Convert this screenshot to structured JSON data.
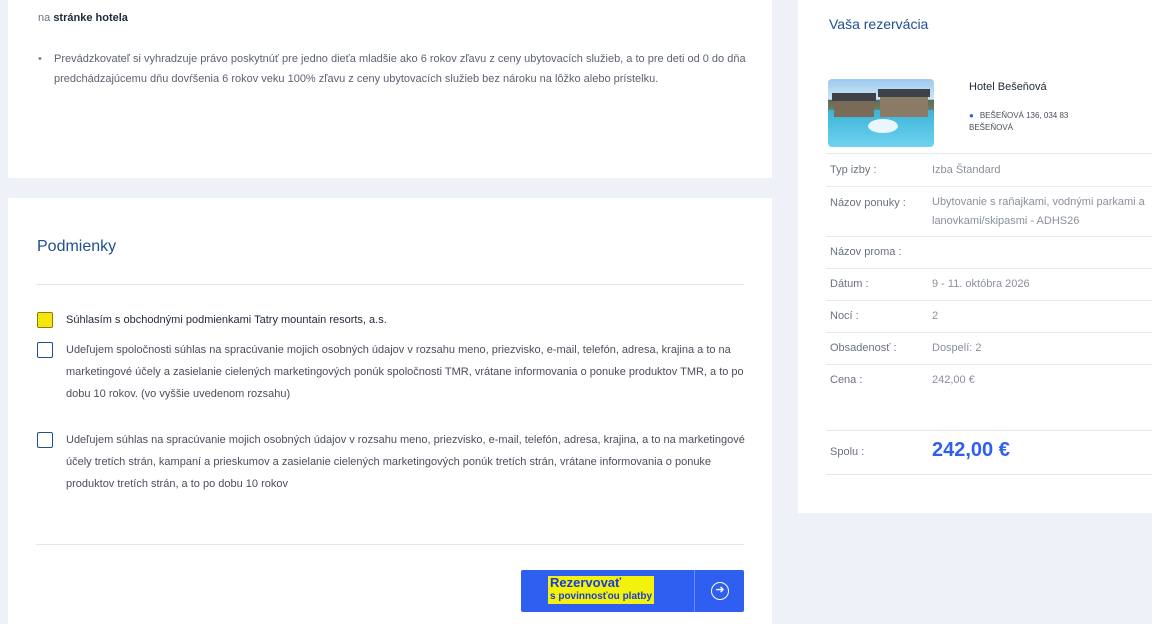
{
  "intro": {
    "prefix": "na",
    "link": "stránke hotela",
    "bullet": "Prevádzkovateľ si vyhradzuje právo poskytnúť pre jedno dieťa mladšie ako 6 rokov zľavu z ceny ubytovacích služieb, a to pre deti od 0 do dňa predchádzajúcemu dňu dovŕšenia 6 rokov veku 100% zľavu z ceny ubytovacích služieb bez nároku na lôžko alebo prístelku."
  },
  "conditions": {
    "title": "Podmienky",
    "items": [
      {
        "label": "Súhlasím s obchodnými podmienkami Tatry mountain resorts, a.s.",
        "checked": false,
        "highlighted": true
      },
      {
        "label": "Udeľujem spoločnosti súhlas na spracúvanie mojich osobných údajov v rozsahu meno, priezvisko, e-mail, telefón, adresa, krajina a to na marketingové účely a zasielanie cielených marketingových ponúk spoločnosti TMR, vrátane informovania o ponuke produktov TMR, a to po dobu 10 rokov. (vo vyššie uvedenom rozsahu)",
        "checked": false
      },
      {
        "label": "Udeľujem súhlas na spracúvanie mojich osobných údajov v rozsahu meno, priezvisko, e-mail, telefón, adresa, krajina, a to na marketingové účely tretích strán, kampaní a prieskumov a zasielanie cielených marketingových ponúk tretích strán, vrátane informovania o ponuke produktov tretích strán, a to po dobu 10 rokov",
        "checked": false
      }
    ],
    "button_line1": "Rezervovať",
    "button_line2": "s povinnosťou platby",
    "button_icon": "arrow-circle-right-icon"
  },
  "reservation": {
    "title": "Vaša rezervácia",
    "hotel_name": "Hotel Bešeňová",
    "address_line1": "BEŠEŇOVÁ 136, 034 83",
    "address_line2": "BEŠEŇOVÁ",
    "rows": [
      {
        "key": "Typ izby :",
        "value": "Izba Štandard"
      },
      {
        "key": "Názov ponuky :",
        "value": "Ubytovanie s raňajkami, vodnými parkami a lanovkami/skipasmi - ADHS26"
      },
      {
        "key": "Názov proma :",
        "value": ""
      },
      {
        "key": "Dátum :",
        "value": "9 - 11. októbra 2026"
      },
      {
        "key": "Nocí :",
        "value": "2"
      },
      {
        "key": "Obsadenosť :",
        "value": "Dospelí: 2"
      },
      {
        "key": "Cena :",
        "value": "242,00 €"
      }
    ],
    "total_label": "Spolu :",
    "total_value": "242,00 €"
  },
  "colors": {
    "accent": "#2f5ff0",
    "heading": "#1e4f8f",
    "highlight": "#f5e60a"
  }
}
